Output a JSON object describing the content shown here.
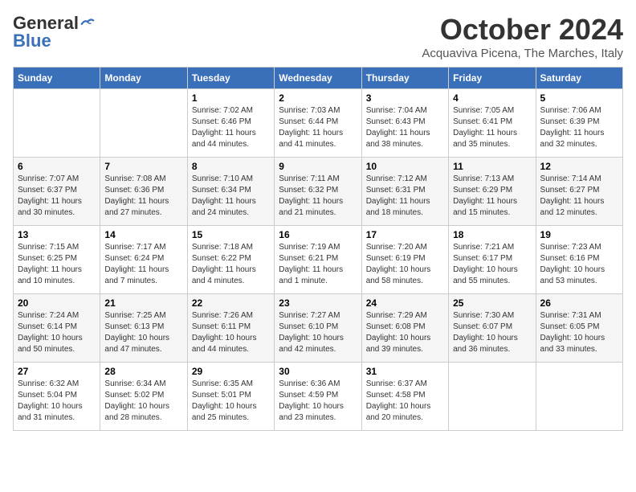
{
  "header": {
    "logo_line1": "General",
    "logo_line2": "Blue",
    "month": "October 2024",
    "location": "Acquaviva Picena, The Marches, Italy"
  },
  "days_of_week": [
    "Sunday",
    "Monday",
    "Tuesday",
    "Wednesday",
    "Thursday",
    "Friday",
    "Saturday"
  ],
  "weeks": [
    [
      {
        "day": "",
        "info": ""
      },
      {
        "day": "",
        "info": ""
      },
      {
        "day": "1",
        "info": "Sunrise: 7:02 AM\nSunset: 6:46 PM\nDaylight: 11 hours and 44 minutes."
      },
      {
        "day": "2",
        "info": "Sunrise: 7:03 AM\nSunset: 6:44 PM\nDaylight: 11 hours and 41 minutes."
      },
      {
        "day": "3",
        "info": "Sunrise: 7:04 AM\nSunset: 6:43 PM\nDaylight: 11 hours and 38 minutes."
      },
      {
        "day": "4",
        "info": "Sunrise: 7:05 AM\nSunset: 6:41 PM\nDaylight: 11 hours and 35 minutes."
      },
      {
        "day": "5",
        "info": "Sunrise: 7:06 AM\nSunset: 6:39 PM\nDaylight: 11 hours and 32 minutes."
      }
    ],
    [
      {
        "day": "6",
        "info": "Sunrise: 7:07 AM\nSunset: 6:37 PM\nDaylight: 11 hours and 30 minutes."
      },
      {
        "day": "7",
        "info": "Sunrise: 7:08 AM\nSunset: 6:36 PM\nDaylight: 11 hours and 27 minutes."
      },
      {
        "day": "8",
        "info": "Sunrise: 7:10 AM\nSunset: 6:34 PM\nDaylight: 11 hours and 24 minutes."
      },
      {
        "day": "9",
        "info": "Sunrise: 7:11 AM\nSunset: 6:32 PM\nDaylight: 11 hours and 21 minutes."
      },
      {
        "day": "10",
        "info": "Sunrise: 7:12 AM\nSunset: 6:31 PM\nDaylight: 11 hours and 18 minutes."
      },
      {
        "day": "11",
        "info": "Sunrise: 7:13 AM\nSunset: 6:29 PM\nDaylight: 11 hours and 15 minutes."
      },
      {
        "day": "12",
        "info": "Sunrise: 7:14 AM\nSunset: 6:27 PM\nDaylight: 11 hours and 12 minutes."
      }
    ],
    [
      {
        "day": "13",
        "info": "Sunrise: 7:15 AM\nSunset: 6:25 PM\nDaylight: 11 hours and 10 minutes."
      },
      {
        "day": "14",
        "info": "Sunrise: 7:17 AM\nSunset: 6:24 PM\nDaylight: 11 hours and 7 minutes."
      },
      {
        "day": "15",
        "info": "Sunrise: 7:18 AM\nSunset: 6:22 PM\nDaylight: 11 hours and 4 minutes."
      },
      {
        "day": "16",
        "info": "Sunrise: 7:19 AM\nSunset: 6:21 PM\nDaylight: 11 hours and 1 minute."
      },
      {
        "day": "17",
        "info": "Sunrise: 7:20 AM\nSunset: 6:19 PM\nDaylight: 10 hours and 58 minutes."
      },
      {
        "day": "18",
        "info": "Sunrise: 7:21 AM\nSunset: 6:17 PM\nDaylight: 10 hours and 55 minutes."
      },
      {
        "day": "19",
        "info": "Sunrise: 7:23 AM\nSunset: 6:16 PM\nDaylight: 10 hours and 53 minutes."
      }
    ],
    [
      {
        "day": "20",
        "info": "Sunrise: 7:24 AM\nSunset: 6:14 PM\nDaylight: 10 hours and 50 minutes."
      },
      {
        "day": "21",
        "info": "Sunrise: 7:25 AM\nSunset: 6:13 PM\nDaylight: 10 hours and 47 minutes."
      },
      {
        "day": "22",
        "info": "Sunrise: 7:26 AM\nSunset: 6:11 PM\nDaylight: 10 hours and 44 minutes."
      },
      {
        "day": "23",
        "info": "Sunrise: 7:27 AM\nSunset: 6:10 PM\nDaylight: 10 hours and 42 minutes."
      },
      {
        "day": "24",
        "info": "Sunrise: 7:29 AM\nSunset: 6:08 PM\nDaylight: 10 hours and 39 minutes."
      },
      {
        "day": "25",
        "info": "Sunrise: 7:30 AM\nSunset: 6:07 PM\nDaylight: 10 hours and 36 minutes."
      },
      {
        "day": "26",
        "info": "Sunrise: 7:31 AM\nSunset: 6:05 PM\nDaylight: 10 hours and 33 minutes."
      }
    ],
    [
      {
        "day": "27",
        "info": "Sunrise: 6:32 AM\nSunset: 5:04 PM\nDaylight: 10 hours and 31 minutes."
      },
      {
        "day": "28",
        "info": "Sunrise: 6:34 AM\nSunset: 5:02 PM\nDaylight: 10 hours and 28 minutes."
      },
      {
        "day": "29",
        "info": "Sunrise: 6:35 AM\nSunset: 5:01 PM\nDaylight: 10 hours and 25 minutes."
      },
      {
        "day": "30",
        "info": "Sunrise: 6:36 AM\nSunset: 4:59 PM\nDaylight: 10 hours and 23 minutes."
      },
      {
        "day": "31",
        "info": "Sunrise: 6:37 AM\nSunset: 4:58 PM\nDaylight: 10 hours and 20 minutes."
      },
      {
        "day": "",
        "info": ""
      },
      {
        "day": "",
        "info": ""
      }
    ]
  ]
}
